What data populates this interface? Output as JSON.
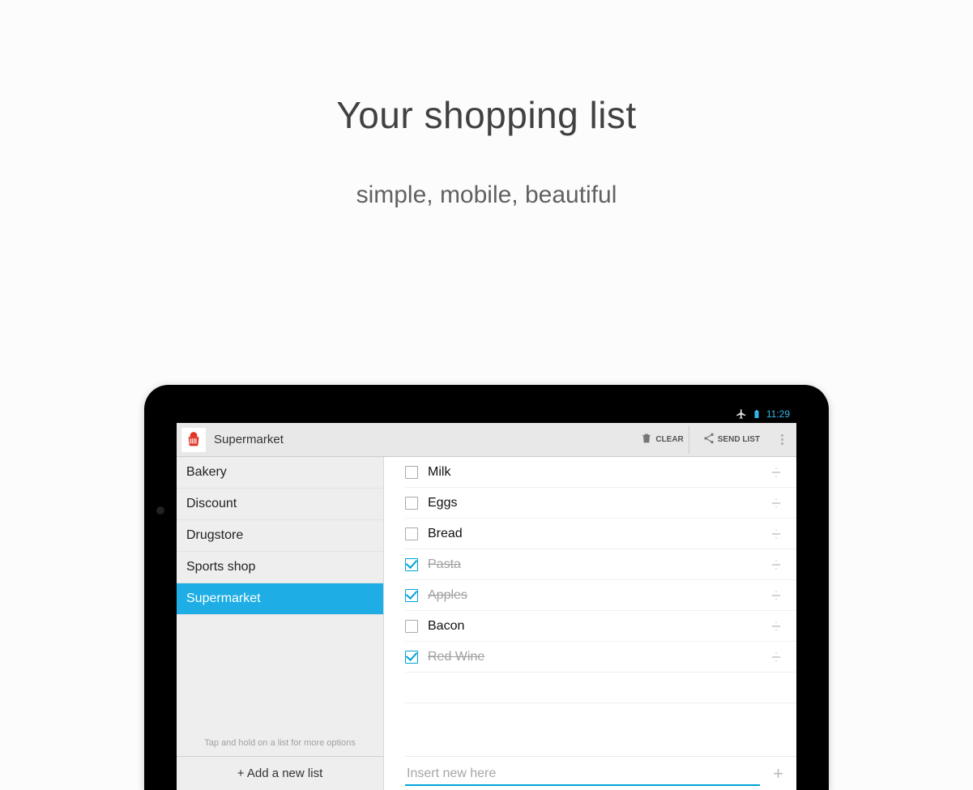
{
  "marketing": {
    "headline": "Your shopping list",
    "subhead": "simple, mobile, beautiful"
  },
  "statusbar": {
    "time": "11:29"
  },
  "actionbar": {
    "title": "Supermarket",
    "clear": "CLEAR",
    "send": "SEND LIST"
  },
  "sidebar": {
    "items": [
      {
        "label": "Bakery",
        "selected": false
      },
      {
        "label": "Discount",
        "selected": false
      },
      {
        "label": "Drugstore",
        "selected": false
      },
      {
        "label": "Sports shop",
        "selected": false
      },
      {
        "label": "Supermarket",
        "selected": true
      }
    ],
    "hint": "Tap and hold on a list for more options",
    "add_label": "+ Add a new list"
  },
  "main": {
    "items": [
      {
        "label": "Milk",
        "checked": false
      },
      {
        "label": "Eggs",
        "checked": false
      },
      {
        "label": "Bread",
        "checked": false
      },
      {
        "label": "Pasta",
        "checked": true
      },
      {
        "label": "Apples",
        "checked": true
      },
      {
        "label": "Bacon",
        "checked": false
      },
      {
        "label": "Red Wine",
        "checked": true
      }
    ],
    "insert_placeholder": "Insert new here"
  }
}
